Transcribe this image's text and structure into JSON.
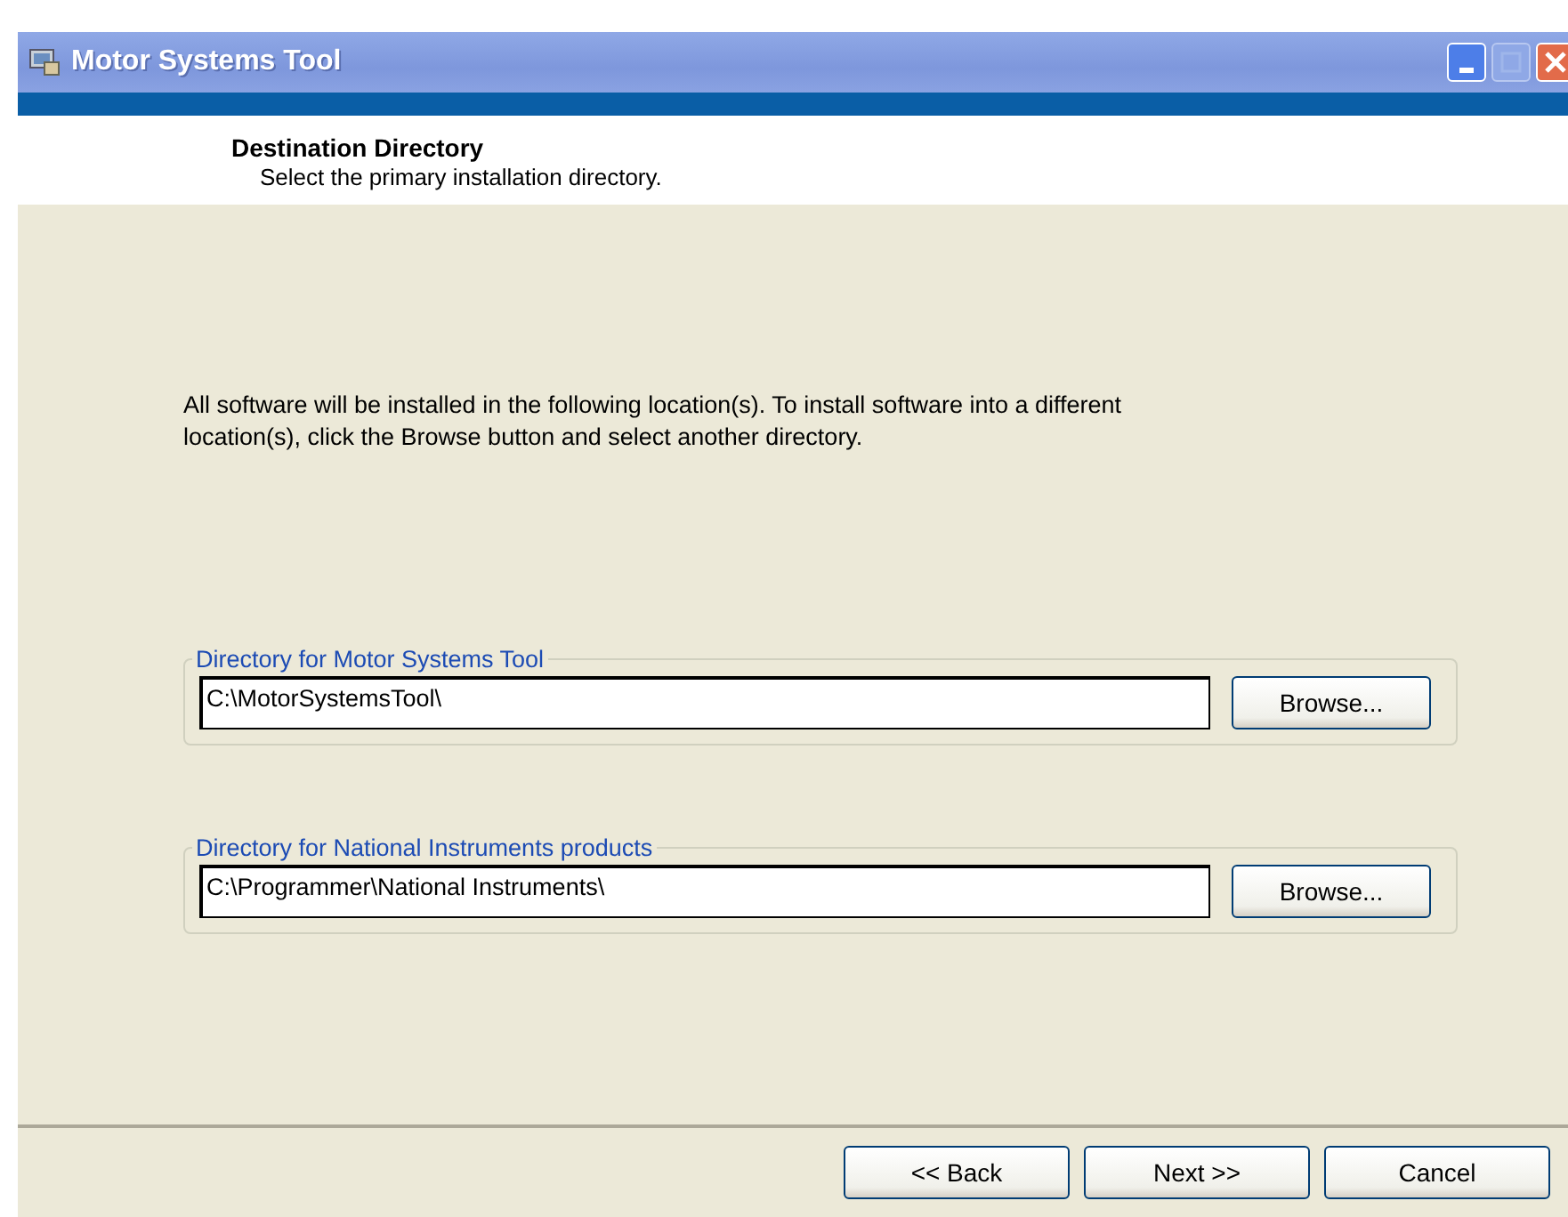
{
  "window": {
    "title": "Motor Systems Tool"
  },
  "header": {
    "title": "Destination Directory",
    "subtitle": "Select the primary installation directory."
  },
  "description": "All software will be installed in the following location(s). To install software into a different location(s), click the Browse button and select another directory.",
  "directories": [
    {
      "label": "Directory for Motor Systems Tool",
      "value": "C:\\MotorSystemsTool\\",
      "button": "Browse..."
    },
    {
      "label": "Directory for National Instruments products",
      "value": "C:\\Programmer\\National Instruments\\",
      "button": "Browse..."
    }
  ],
  "buttons": [
    "<< Back",
    "Next >>",
    "Cancel"
  ]
}
